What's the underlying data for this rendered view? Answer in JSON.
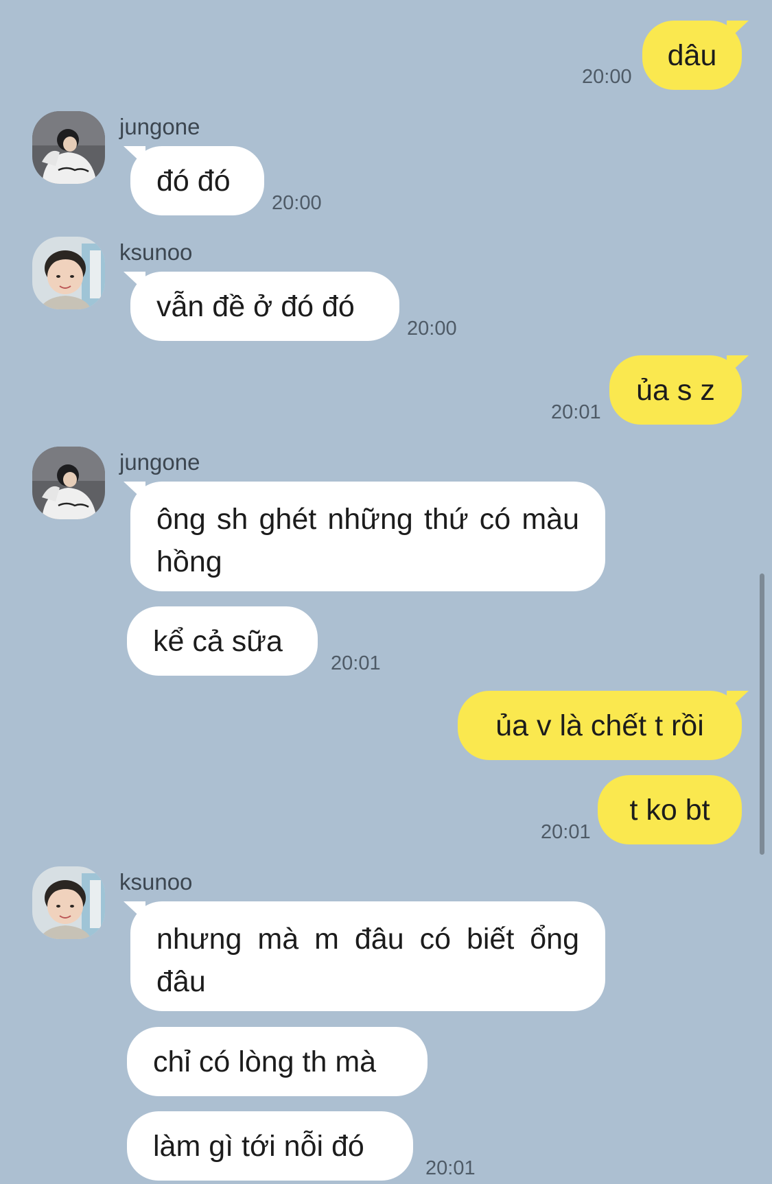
{
  "messages": [
    {
      "text": "dâu",
      "time": "20:00"
    },
    {
      "sender": "jungone",
      "text": "đó đó",
      "time": "20:00"
    },
    {
      "sender": "ksunoo",
      "text": "vẫn đề ở đó đó",
      "time": "20:00"
    },
    {
      "text": "ủa s z",
      "time": "20:01"
    },
    {
      "sender": "jungone",
      "text": "ông sh ghét những thứ có màu hồng"
    },
    {
      "text": "kể cả sữa",
      "time": "20:01"
    },
    {
      "text": "ủa v là chết t rồi"
    },
    {
      "text": "t ko bt",
      "time": "20:01"
    },
    {
      "sender": "ksunoo",
      "text": "nhưng mà m đâu có biết ổng đâu"
    },
    {
      "text": "chỉ có lòng th mà"
    },
    {
      "text": "làm gì tới nỗi đó",
      "time": "20:01"
    }
  ],
  "colors": {
    "background": "#acbfd1",
    "incoming_bubble": "#ffffff",
    "outgoing_bubble": "#fae84f"
  }
}
